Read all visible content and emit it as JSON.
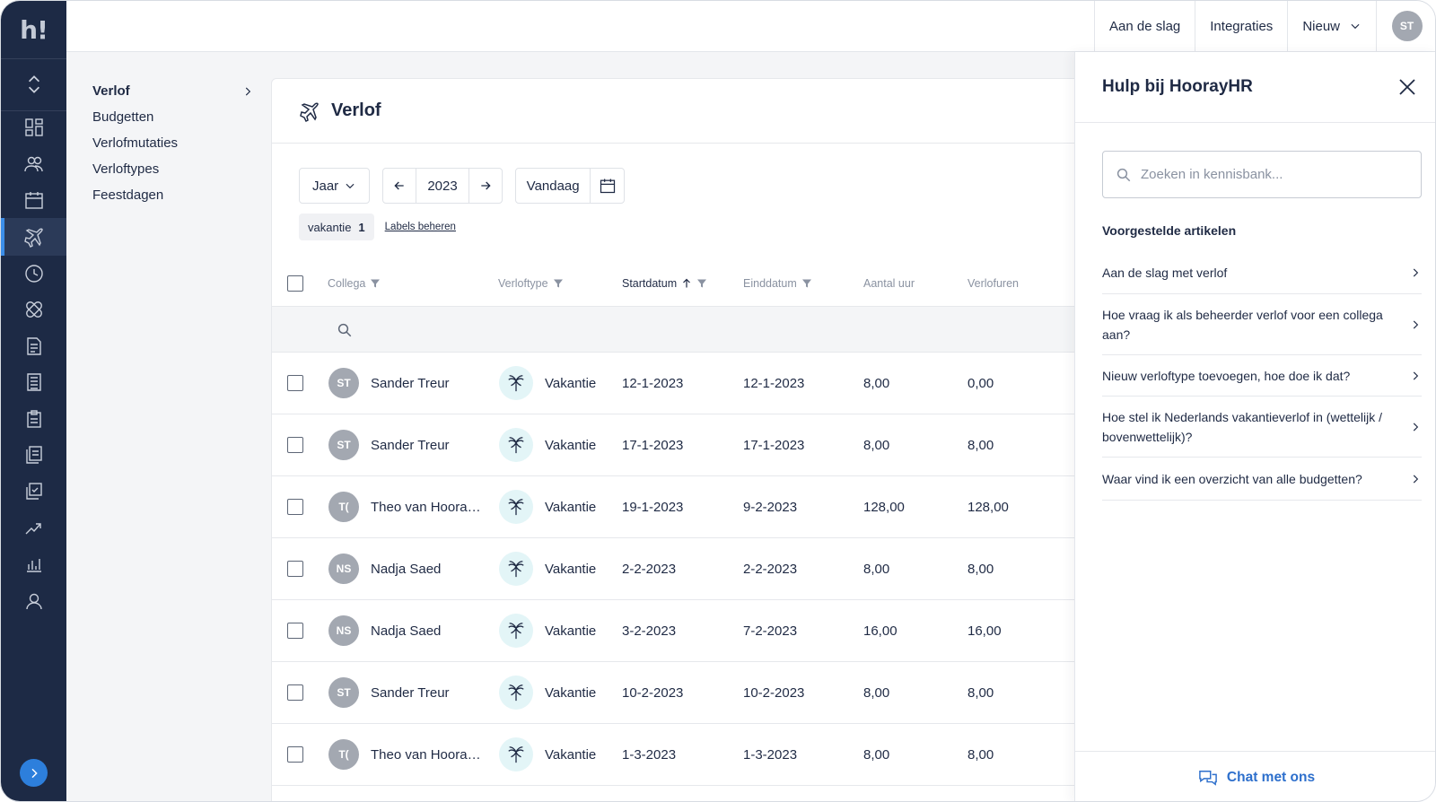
{
  "brand": {
    "logo": "h!"
  },
  "topnav": {
    "get_started": "Aan de slag",
    "integrations": "Integraties",
    "new": "Nieuw",
    "user_initials": "ST"
  },
  "subnav": {
    "items": [
      "Verlof",
      "Budgetten",
      "Verlofmutaties",
      "Verloftypes",
      "Feestdagen"
    ]
  },
  "page": {
    "title": "Verlof"
  },
  "controls": {
    "period": "Jaar",
    "year": "2023",
    "today": "Vandaag"
  },
  "labels": {
    "tag_name": "vakantie",
    "tag_count": "1",
    "manage_link": "Labels beheren"
  },
  "table": {
    "columns": {
      "colleague": "Collega",
      "leave_type": "Verloftype",
      "start": "Startdatum",
      "end": "Einddatum",
      "hours": "Aantal uur",
      "leave_hours": "Verlofuren"
    },
    "rows": [
      {
        "initials": "ST",
        "name": "Sander Treur",
        "type": "Vakantie",
        "start": "12-1-2023",
        "end": "12-1-2023",
        "hours": "8,00",
        "leave_hours": "0,00"
      },
      {
        "initials": "ST",
        "name": "Sander Treur",
        "type": "Vakantie",
        "start": "17-1-2023",
        "end": "17-1-2023",
        "hours": "8,00",
        "leave_hours": "8,00"
      },
      {
        "initials": "T(",
        "name": "Theo van Hoora…",
        "type": "Vakantie",
        "start": "19-1-2023",
        "end": "9-2-2023",
        "hours": "128,00",
        "leave_hours": "128,00"
      },
      {
        "initials": "NS",
        "name": "Nadja Saed",
        "type": "Vakantie",
        "start": "2-2-2023",
        "end": "2-2-2023",
        "hours": "8,00",
        "leave_hours": "8,00"
      },
      {
        "initials": "NS",
        "name": "Nadja Saed",
        "type": "Vakantie",
        "start": "3-2-2023",
        "end": "7-2-2023",
        "hours": "16,00",
        "leave_hours": "16,00"
      },
      {
        "initials": "ST",
        "name": "Sander Treur",
        "type": "Vakantie",
        "start": "10-2-2023",
        "end": "10-2-2023",
        "hours": "8,00",
        "leave_hours": "8,00"
      },
      {
        "initials": "T(",
        "name": "Theo van Hoora…",
        "type": "Vakantie",
        "start": "1-3-2023",
        "end": "1-3-2023",
        "hours": "8,00",
        "leave_hours": "8,00"
      }
    ]
  },
  "help": {
    "title": "Hulp bij HoorayHR",
    "search_placeholder": "Zoeken in kennisbank...",
    "suggested_heading": "Voorgestelde artikelen",
    "articles": [
      "Aan de slag met verlof",
      "Hoe vraag ik als beheerder verlof voor een collega aan?",
      "Nieuw verloftype toevoegen, hoe doe ik dat?",
      "Hoe stel ik Nederlands vakantieverlof in (wettelijk / bovenwettelijk)?",
      "Waar vind ik een overzicht van alle budgetten?"
    ],
    "chat": "Chat met ons"
  },
  "icons": [
    "expand-icon",
    "dashboard-icon",
    "team-icon",
    "calendar-icon",
    "plane-icon",
    "clock-icon",
    "bandage-icon",
    "document-icon",
    "receipt-icon",
    "clipboard-icon",
    "files-icon",
    "checklist-icon",
    "handshake-icon",
    "chart-icon",
    "person-icon",
    "arrow-right-icon"
  ],
  "colors": {
    "rail": "#1d2a45",
    "accent": "#2d7fdc",
    "palm_bg": "#e3f5f7"
  }
}
